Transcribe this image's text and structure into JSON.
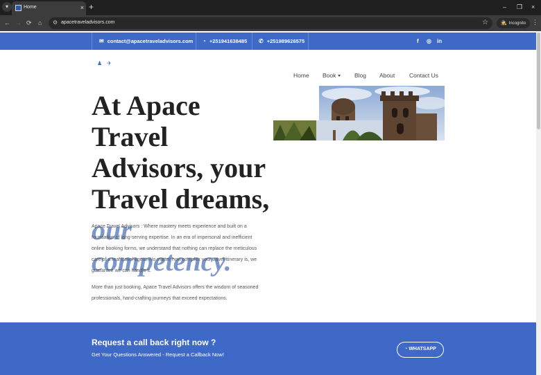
{
  "browser": {
    "menu_icon": "chevron-down-icon",
    "tab_title": "Home",
    "tab_close": "×",
    "new_tab": "+",
    "url": "apacetraveladvisors.com",
    "incognito_label": "Incognito",
    "window_min": "–",
    "window_restore": "❐",
    "window_close": "×",
    "back": "←",
    "forward": "→",
    "reload": "⟳",
    "home": "⌂",
    "star": "☆",
    "more": "⋮"
  },
  "topbar": {
    "email": "contact@apacetraveladvisors.com",
    "phone1": "+251941638485",
    "phone2": "+251989626575",
    "social": [
      "f",
      "◎",
      "in"
    ]
  },
  "nav": {
    "items": [
      "Home",
      "Book",
      "Blog",
      "About",
      "Contact Us"
    ]
  },
  "hero": {
    "title_main": "At Apace Travel Advisors, your Travel dreams,",
    "title_accent": "our competency.",
    "para1": "Apace Travel Advisors : Where mastery meets experience and built on a foundation of long-serving expertise. In an era of impersonal and inefficient online booking forms, we understand that nothing can replace the meticulous care of a real travel agent. No matter how complex your travel itinerary is, we guarantee we can handle it.",
    "para2": "More than just booking, Apace Travel Advisors offers the wisdom of seasoned professionals, hand-crafting journeys that exceed expectations."
  },
  "cta": {
    "title": "Request a call back right now ?",
    "subtitle": "Get Your Questions Answered - Request a Callback Now!",
    "button": "WHATSAPP"
  },
  "colors": {
    "brand_blue": "#3f69c7",
    "accent_text": "#7b96c9"
  }
}
